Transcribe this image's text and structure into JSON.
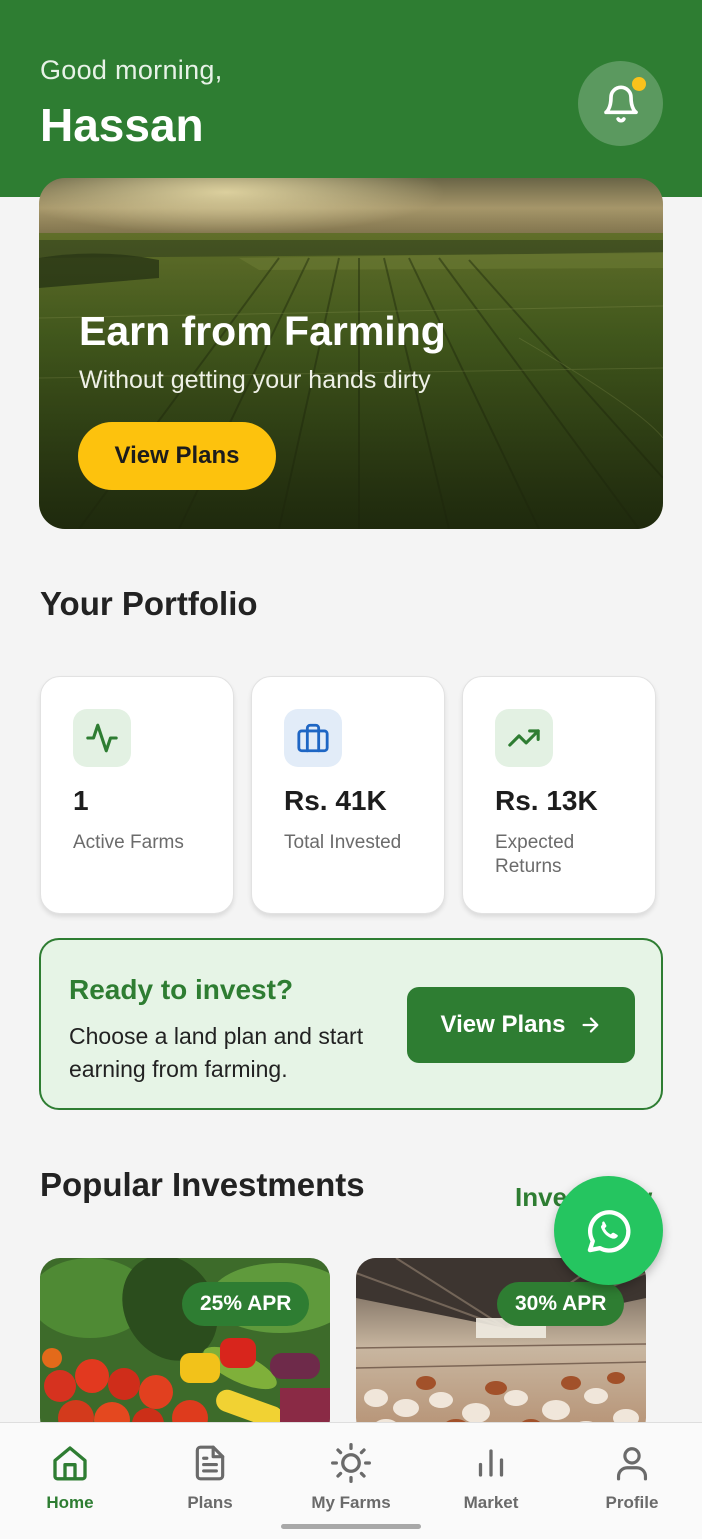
{
  "header": {
    "greeting": "Good morning,",
    "user_name": "Hassan",
    "notification_icon": "bell-icon",
    "has_unread": true
  },
  "hero": {
    "title": "Earn from Farming",
    "subtitle": "Without getting your hands dirty",
    "button_label": "View Plans"
  },
  "portfolio": {
    "title": "Your Portfolio",
    "stats": [
      {
        "icon": "activity-icon",
        "value": "1",
        "label": "Active Farms"
      },
      {
        "icon": "briefcase-icon",
        "value": "Rs. 41K",
        "label": "Total Invested"
      },
      {
        "icon": "trending-up-icon",
        "value": "Rs. 13K",
        "label": "Expected Returns"
      }
    ]
  },
  "cta": {
    "title": "Ready to invest?",
    "text": "Choose a land plan and start earning from farming.",
    "button_label": "View Plans"
  },
  "popular": {
    "title": "Popular Investments",
    "link_label": "Invest Now",
    "cards": [
      {
        "apr": "25% APR",
        "image": "vegetables-photo"
      },
      {
        "apr": "30% APR",
        "image": "poultry-farm-photo"
      }
    ]
  },
  "nav": {
    "items": [
      {
        "label": "Home",
        "icon": "home-icon",
        "active": true
      },
      {
        "label": "Plans",
        "icon": "document-icon",
        "active": false
      },
      {
        "label": "My Farms",
        "icon": "sun-icon",
        "active": false
      },
      {
        "label": "Market",
        "icon": "bar-chart-icon",
        "active": false
      },
      {
        "label": "Profile",
        "icon": "user-icon",
        "active": false
      }
    ]
  },
  "colors": {
    "brand_green": "#2e7d32",
    "accent_yellow": "#fdc20d",
    "whatsapp_green": "#25c560"
  }
}
